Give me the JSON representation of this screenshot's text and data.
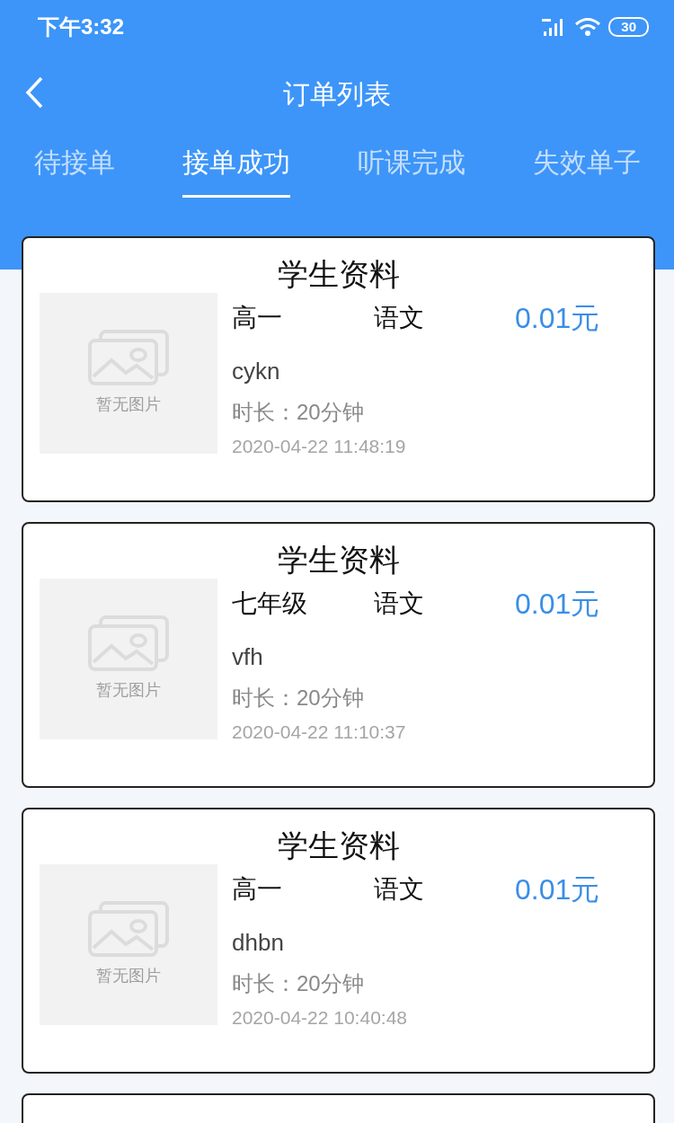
{
  "status_bar": {
    "time": "下午3:32",
    "battery": "30"
  },
  "header": {
    "title": "订单列表"
  },
  "tabs": [
    {
      "label": "待接单",
      "selected": false
    },
    {
      "label": "接单成功",
      "selected": true
    },
    {
      "label": "听课完成",
      "selected": false
    },
    {
      "label": "失效单子",
      "selected": false
    }
  ],
  "orders": [
    {
      "title": "学生资料",
      "image_text": "暂无图片",
      "grade": "高一",
      "subject": "语文",
      "price": "0.01元",
      "name": "cykn",
      "duration": "时长：20分钟",
      "time": "2020-04-22 11:48:19"
    },
    {
      "title": "学生资料",
      "image_text": "暂无图片",
      "grade": "七年级",
      "subject": "语文",
      "price": "0.01元",
      "name": "vfh",
      "duration": "时长：20分钟",
      "time": "2020-04-22 11:10:37"
    },
    {
      "title": "学生资料",
      "image_text": "暂无图片",
      "grade": "高一",
      "subject": "语文",
      "price": "0.01元",
      "name": "dhbn",
      "duration": "时长：20分钟",
      "time": "2020-04-22 10:40:48"
    }
  ]
}
